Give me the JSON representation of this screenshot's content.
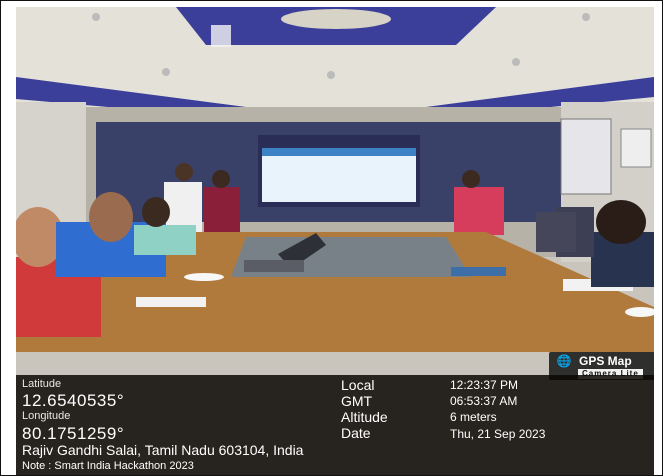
{
  "badge": {
    "icon": "globe-icon",
    "title": "GPS Map",
    "subtitle": "Camera Lite"
  },
  "location": {
    "latitude_label": "Latitude",
    "latitude": "12.6540535°",
    "longitude_label": "Longitude",
    "longitude": "80.1751259°",
    "local_label": "Local",
    "local_time": "12:23:37 PM",
    "gmt_label": "GMT",
    "gmt_time": "06:53:37 AM",
    "altitude_label": "Altitude",
    "altitude": "6 meters",
    "date_label": "Date",
    "date": "Thu, 21 Sep 2023",
    "address": "Rajiv Gandhi Salai, Tamil Nadu 603104, India",
    "note": "Note : Smart India Hackathon 2023"
  },
  "colors": {
    "ceiling_accent": "#3b3f9a",
    "wall_panel": "#3a4168",
    "table_wood": "#b07a3c",
    "overlay_bg": "#0c0804"
  }
}
